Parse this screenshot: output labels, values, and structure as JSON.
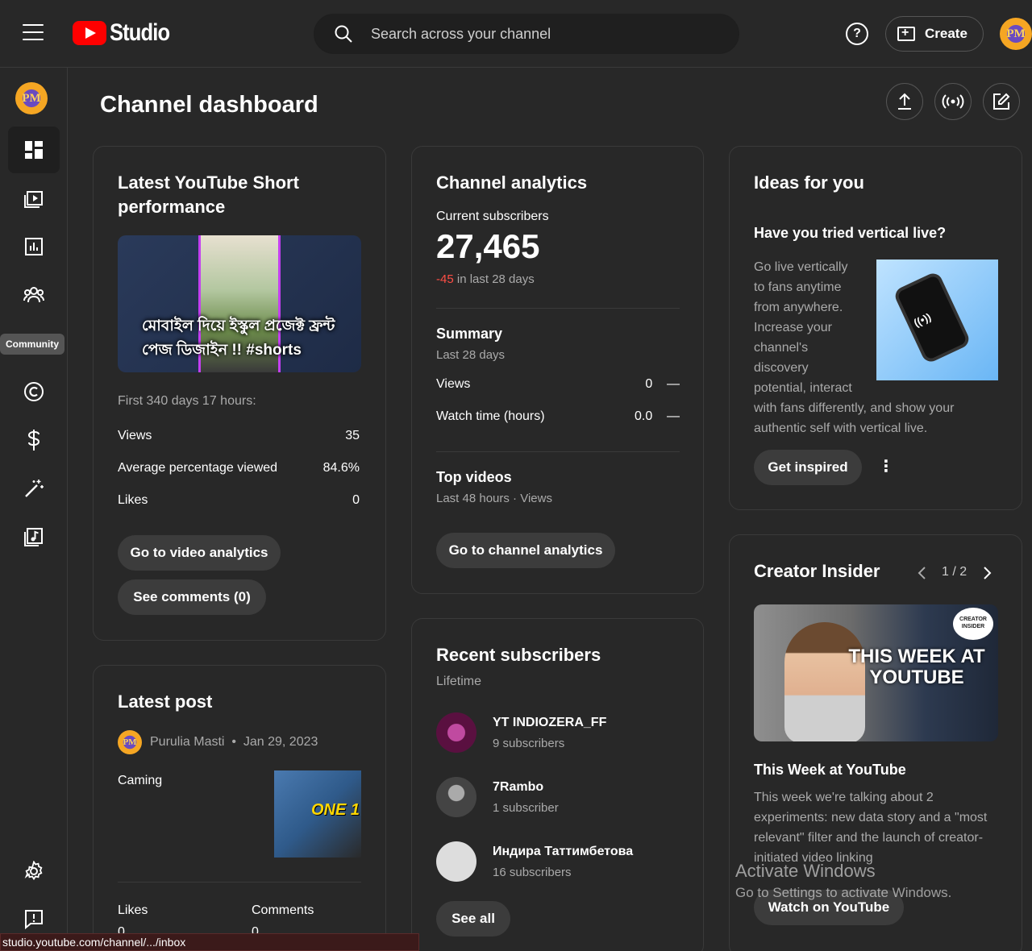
{
  "topbar": {
    "logo_text": "Studio",
    "search_placeholder": "Search across your channel",
    "help_label": "?",
    "create_label": "Create",
    "avatar_initials": "PM"
  },
  "sidebar": {
    "avatar_initials": "PM",
    "items": [
      {
        "name": "dashboard",
        "icon": "dashboard-icon",
        "active": true
      },
      {
        "name": "content",
        "icon": "content-icon"
      },
      {
        "name": "analytics",
        "icon": "analytics-icon"
      },
      {
        "name": "community",
        "icon": "community-icon",
        "tooltip": "Community"
      },
      {
        "name": "copyright",
        "icon": "copyright-icon"
      },
      {
        "name": "earn",
        "icon": "dollar-icon"
      },
      {
        "name": "customization",
        "icon": "magic-wand-icon"
      },
      {
        "name": "audio-library",
        "icon": "audio-library-icon"
      },
      {
        "name": "settings",
        "icon": "gear-icon"
      },
      {
        "name": "feedback",
        "icon": "feedback-icon"
      }
    ]
  },
  "page": {
    "title": "Channel dashboard",
    "header_actions": [
      "upload-icon",
      "go-live-icon",
      "create-post-icon"
    ]
  },
  "short_card": {
    "title": "Latest YouTube Short performance",
    "thumb_text": "মোবাইল দিয়ে ইস্কুল প্রজেক্ট ফ্রন্ট পেজ ডিজাইন !! #shorts",
    "period": "First 340 days 17 hours:",
    "stats": [
      {
        "label": "Views",
        "value": "35"
      },
      {
        "label": "Average percentage viewed",
        "value": "84.6%"
      },
      {
        "label": "Likes",
        "value": "0"
      }
    ],
    "btn_analytics": "Go to video analytics",
    "btn_comments": "See comments (0)"
  },
  "analytics_card": {
    "title": "Channel analytics",
    "subs_label": "Current subscribers",
    "subs_value": "27,465",
    "subs_delta": "-45",
    "subs_delta_suffix": " in last 28 days",
    "summary_title": "Summary",
    "summary_period": "Last 28 days",
    "summary_rows": [
      {
        "label": "Views",
        "value": "0",
        "trend": "—"
      },
      {
        "label": "Watch time (hours)",
        "value": "0.0",
        "trend": "—"
      }
    ],
    "top_videos_title": "Top videos",
    "top_videos_period": "Last 48 hours · Views",
    "btn_label": "Go to channel analytics"
  },
  "ideas_card": {
    "title": "Ideas for you",
    "heading": "Have you tried vertical live?",
    "body_lines": [
      "Go live vertically",
      "to fans anytime",
      "from anywhere.",
      "Increase your",
      "channel's",
      "discovery",
      "potential, interact"
    ],
    "body_full_lines": [
      "with fans differently, and show your",
      "authentic self with vertical live."
    ],
    "btn_label": "Get inspired",
    "more_label": "⋮"
  },
  "creator_card": {
    "title": "Creator Insider",
    "pager": "1 / 2",
    "thumb_text": "THIS WEEK AT YOUTUBE",
    "badge_text": "CREATOR INSIDER",
    "video_title": "This Week at YouTube",
    "desc_lines": [
      "This week we're talking about 2",
      "experiments: new data story and a \"most",
      "relevant\" filter and the launch of creator-",
      "initiated video linking"
    ],
    "btn_label": "Watch on YouTube"
  },
  "post_card": {
    "title": "Latest post",
    "author": "Purulia Masti",
    "date": "Jan 29, 2023",
    "text": "Caming",
    "thumb_text": "ONE 1",
    "col_likes": "Likes",
    "col_comments": "Comments",
    "likes_value": "0",
    "comments_value": "0"
  },
  "subs_card": {
    "title": "Recent subscribers",
    "period": "Lifetime",
    "items": [
      {
        "name": "YT INDIOZERA_FF",
        "count": "9 subscribers",
        "color": "#7a1a5a"
      },
      {
        "name": "7Rambo",
        "count": "1 subscriber",
        "color": "#555555"
      },
      {
        "name": "Индира Таттимбетова",
        "count": "16 subscribers",
        "color": "#dddddd"
      }
    ],
    "btn_label": "See all"
  },
  "os_overlay": {
    "line1": "Activate Windows",
    "line2": "Go to Settings to activate Windows."
  },
  "statusbar": {
    "url": "studio.youtube.com/channel/.../inbox"
  },
  "colors": {
    "bg": "#282828",
    "accent_red": "#ff0000",
    "negative": "#ff4e45"
  }
}
